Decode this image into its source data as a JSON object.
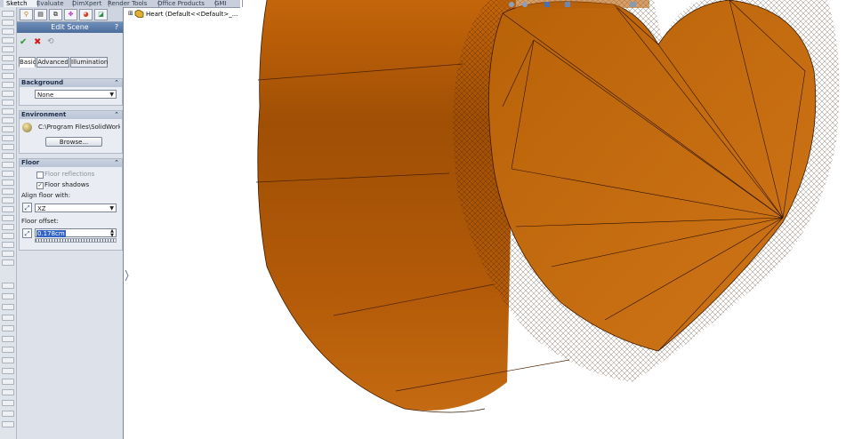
{
  "command_tabs": [
    "Sketch",
    "Evaluate",
    "DimXpert",
    "Render Tools",
    "Office Products",
    "GMI"
  ],
  "active_tab": "Sketch",
  "pm_tab_icons": [
    "feature-manager-icon",
    "property-manager-icon",
    "configuration-manager-icon",
    "dimxpert-manager-icon",
    "display-manager-icon",
    "appearances-icon"
  ],
  "panel": {
    "title": "Edit Scene",
    "help": "?",
    "subtabs": [
      "Basic",
      "Advanced",
      "Illumination"
    ],
    "background": {
      "header": "Background",
      "value": "None"
    },
    "environment": {
      "header": "Environment",
      "path": "C:\\Program Files\\SolidWorks",
      "browse": "Browse..."
    },
    "floor": {
      "header": "Floor",
      "reflections_label": "Floor reflections",
      "reflections_checked": false,
      "shadows_label": "Floor shadows",
      "shadows_checked": true,
      "align_label": "Align floor with:",
      "align_value": "XZ",
      "offset_label": "Floor offset:",
      "offset_value": "0.178cm"
    }
  },
  "tree": {
    "label": "Heart  (Default<<Default>_..."
  },
  "model": {
    "color": "#c06a10",
    "shape": "heart"
  }
}
